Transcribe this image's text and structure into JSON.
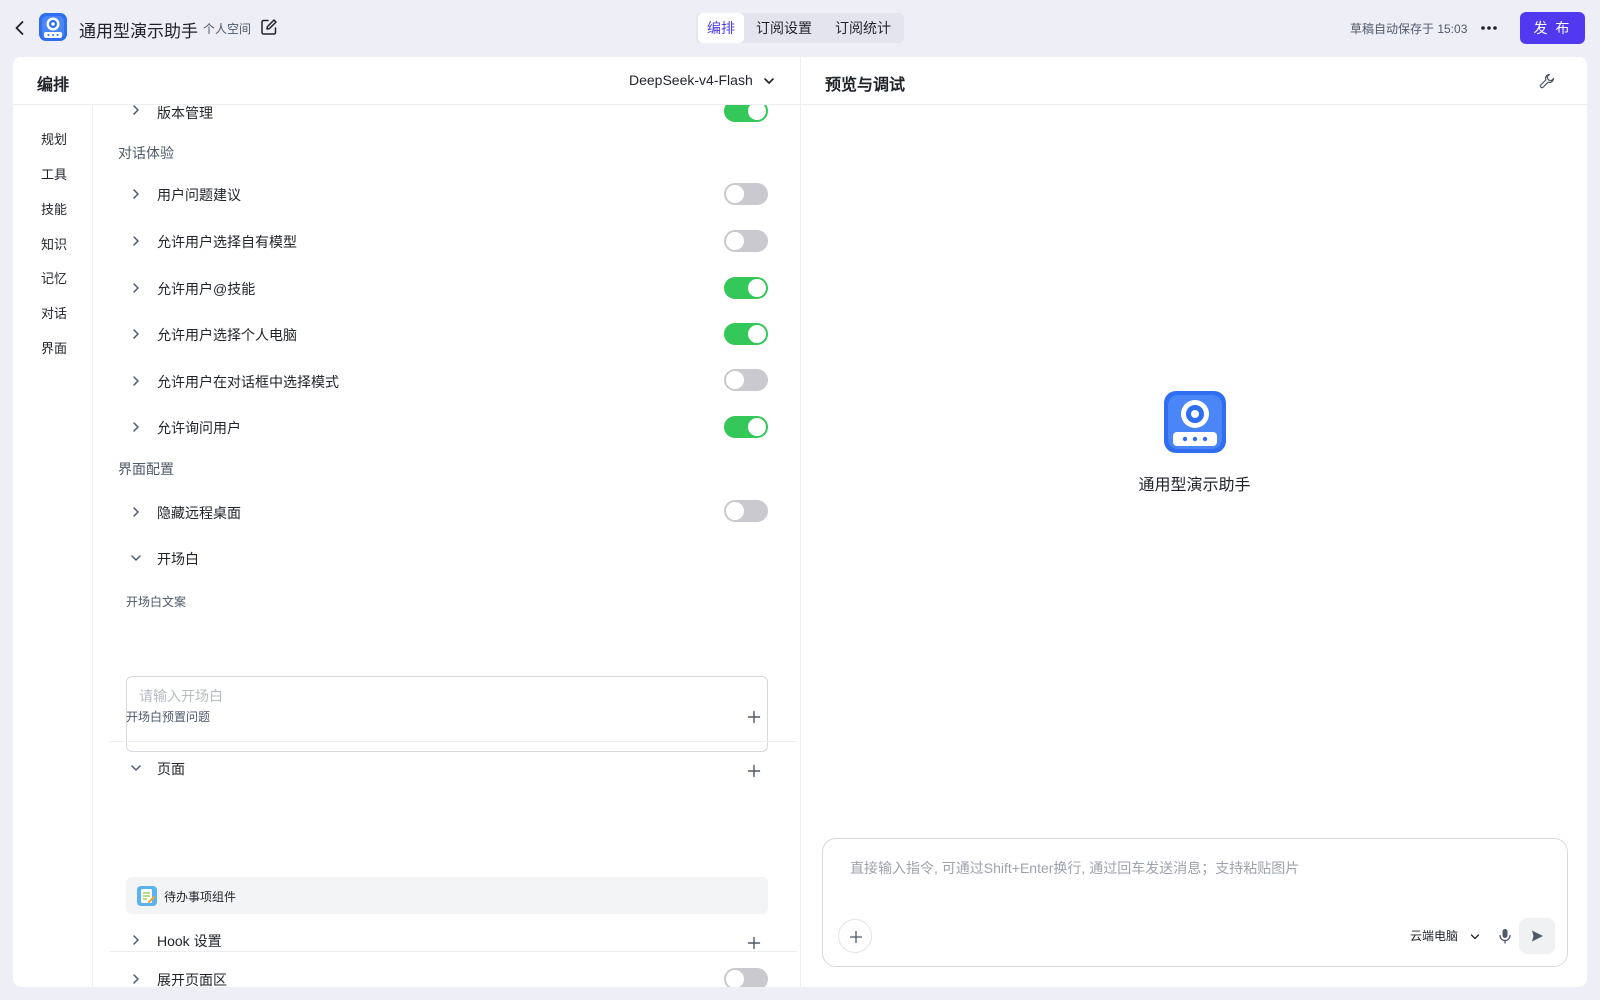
{
  "header": {
    "app_name": "通用型演示助手",
    "space_label": "个人空间",
    "tabs": [
      {
        "label": "编排",
        "active": true
      },
      {
        "label": "订阅设置",
        "active": false
      },
      {
        "label": "订阅统计",
        "active": false
      }
    ],
    "autosave_text": "草稿自动保存于 15:03",
    "publish_label": "发 布",
    "icons": [
      "back-icon",
      "app-logo-icon",
      "edit-icon",
      "more-icon"
    ]
  },
  "left_panel": {
    "title": "编排",
    "model": "DeepSeek-v4-Flash",
    "nav": [
      "规划",
      "工具",
      "技能",
      "知识",
      "记忆",
      "对话",
      "界面"
    ],
    "rows": {
      "version_mgmt": {
        "label": "版本管理",
        "enabled": true
      },
      "conversation_section": "对话体验",
      "suggestions": {
        "label": "用户问题建议",
        "enabled": false
      },
      "own_model": {
        "label": "允许用户选择自有模型",
        "enabled": false
      },
      "at_skill": {
        "label": "允许用户@技能",
        "enabled": true
      },
      "personal_pc": {
        "label": "允许用户选择个人电脑",
        "enabled": true
      },
      "mode_select": {
        "label": "允许用户在对话框中选择模式",
        "enabled": false
      },
      "ask_user": {
        "label": "允许询问用户",
        "enabled": true
      },
      "ui_section": "界面配置",
      "hide_remote": {
        "label": "隐藏远程桌面",
        "enabled": false
      },
      "opening": {
        "label": "开场白"
      },
      "opening_text_label": "开场白文案",
      "opening_placeholder": "请输入开场白",
      "opening_questions_label": "开场白预置问题",
      "pages": {
        "label": "页面"
      },
      "widget": {
        "label": "待办事项组件"
      },
      "expand_page": {
        "label": "展开页面区",
        "enabled": false
      },
      "hook": {
        "label": "Hook 设置"
      }
    }
  },
  "right_panel": {
    "title": "预览与调试",
    "assistant_name": "通用型演示助手",
    "chat_placeholder": "直接输入指令, 可通过Shift+Enter换行, 通过回车发送消息；支持粘贴图片",
    "device": "云端电脑"
  },
  "colors": {
    "accent": "#5039ef",
    "toggle_on": "#34c759",
    "toggle_off": "#c9c9cf",
    "logo_blue": "#2f6ef0"
  }
}
